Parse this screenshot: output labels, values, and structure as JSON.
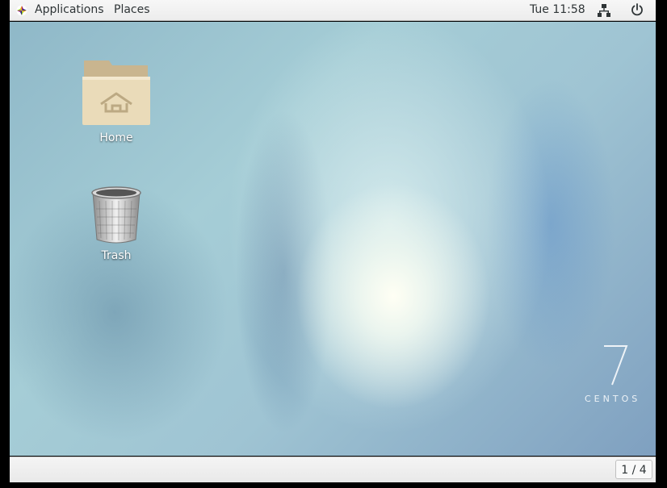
{
  "topbar": {
    "applications_label": "Applications",
    "places_label": "Places",
    "clock": "Tue 11:58",
    "icons": {
      "apps": "distributor-logo-icon",
      "network": "network-wired-icon",
      "power": "power-icon"
    }
  },
  "desktop": {
    "icons": [
      {
        "label": "Home",
        "icon": "home-folder-icon"
      },
      {
        "label": "Trash",
        "icon": "trash-icon"
      }
    ],
    "wallpaper": {
      "number": "7",
      "brand": "CENTOS"
    }
  },
  "bottombar": {
    "workspace_indicator": "1 / 4"
  },
  "colors": {
    "panel": "#ececec",
    "text": "#2e3436",
    "folder": "#e9d9b5"
  }
}
